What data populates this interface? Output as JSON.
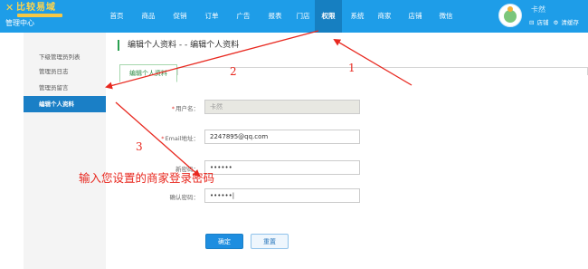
{
  "header": {
    "logo_text": "比较易域",
    "logo_sub": "管理中心",
    "nav": [
      "首页",
      "商品",
      "促销",
      "订单",
      "广告",
      "报表",
      "门店",
      "权限",
      "系统",
      "商家",
      "店铺",
      "微信"
    ],
    "active_nav": "权限",
    "user_name": "卡然",
    "user_links": [
      "店铺",
      "清缓存"
    ]
  },
  "sidebar": {
    "items": [
      "下级管理员列表",
      "管理员日志",
      "管理员留言",
      "编辑个人资料"
    ],
    "active": "编辑个人资料"
  },
  "main": {
    "title": "编辑个人资料 - - 编辑个人资料",
    "tab": "编辑个人资料",
    "form": {
      "username_label": "用户名：",
      "username_value": "卡然",
      "email_label": "Email地址：",
      "email_value": "2247895@qq.com",
      "newpass_label": "新密码：",
      "newpass_value": "••••••",
      "confirm_label": "确认密码：",
      "confirm_value": "••••••|"
    },
    "buttons": {
      "ok": "确定",
      "reset": "重置"
    }
  },
  "annotations": {
    "steps": [
      "1",
      "2",
      "3"
    ],
    "note": "输入您设置的商家登录密码",
    "color": "#e8281f"
  }
}
